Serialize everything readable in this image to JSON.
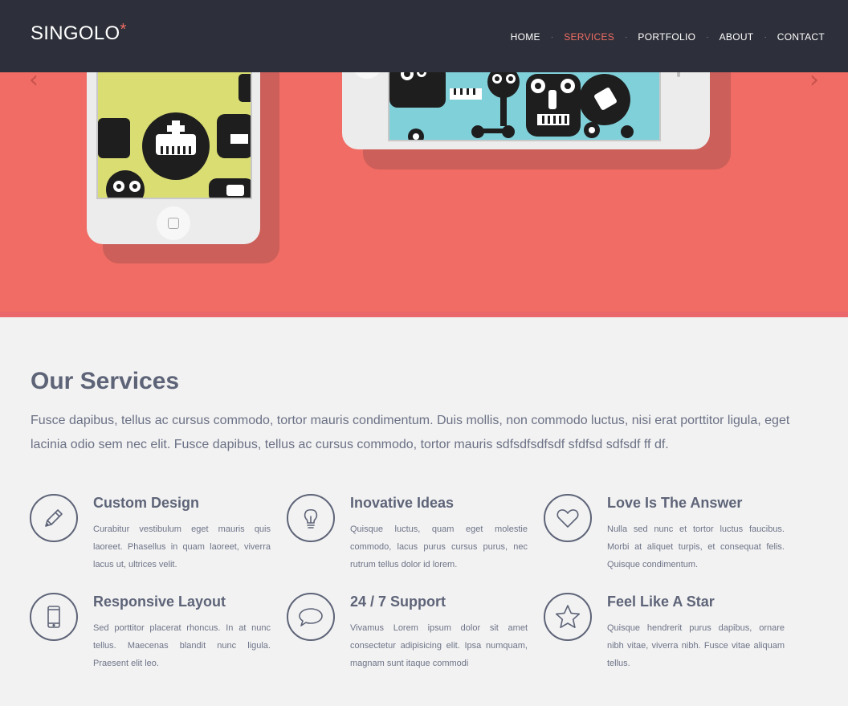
{
  "header": {
    "logo": "SINGOLO",
    "logo_star": "*",
    "nav": [
      {
        "label": "HOME",
        "active": false
      },
      {
        "label": "SERVICES",
        "active": true
      },
      {
        "label": "PORTFOLIO",
        "active": false
      },
      {
        "label": "ABOUT",
        "active": false
      },
      {
        "label": "CONTACT",
        "active": false
      }
    ]
  },
  "hero": {
    "prev_icon": "chevron-left-icon",
    "next_icon": "chevron-right-icon",
    "accent": "#f06c64"
  },
  "services": {
    "title": "Our Services",
    "lead": "Fusce dapibus, tellus ac cursus commodo, tortor mauris condimentum. Duis mollis, non commodo luctus, nisi erat porttitor ligula, eget lacinia odio sem nec elit. Fusce dapibus, tellus ac cursus commodo, tortor mauris sdfsdfsdfsdf sfdfsd sdfsdf ff df.",
    "items": [
      {
        "icon": "pencil-icon",
        "title": "Custom Design",
        "text": "Curabitur vestibulum eget mauris quis laoreet. Phasellus in quam laoreet, viverra lacus ut, ultrices velit."
      },
      {
        "icon": "lightbulb-icon",
        "title": "Inovative Ideas",
        "text": "Quisque luctus, quam eget molestie commodo, lacus purus cursus purus, nec rutrum tellus dolor id lorem."
      },
      {
        "icon": "heart-icon",
        "title": "Love Is The Answer",
        "text": "Nulla sed nunc et tortor luctus faucibus. Morbi at aliquet turpis, et consequat felis. Quisque condimentum."
      },
      {
        "icon": "phone-icon",
        "title": "Responsive Layout",
        "text": "Sed porttitor placerat rhoncus. In at nunc tellus. Maecenas blandit nunc ligula. Praesent elit leo."
      },
      {
        "icon": "chat-bubble-icon",
        "title": "24 / 7 Support",
        "text": "Vivamus Lorem ipsum dolor sit amet consectetur adipisicing elit. Ipsa numquam, magnam sunt itaque commodi"
      },
      {
        "icon": "star-icon",
        "title": "Feel Like A Star",
        "text": "Quisque hendrerit purus dapibus, ornare nibh vitae, viverra nibh. Fusce vitae aliquam tellus."
      }
    ]
  }
}
